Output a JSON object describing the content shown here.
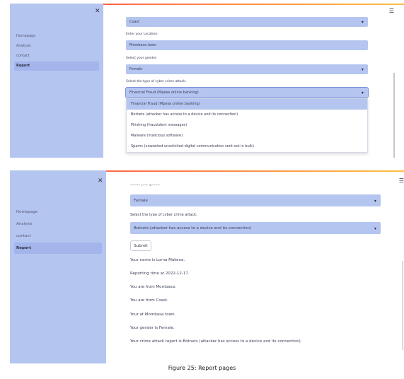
{
  "panel1": {
    "nav": [
      "Homepage",
      "Analysis",
      "contact",
      "Report"
    ],
    "active_nav": "Report",
    "region_value": "Coast",
    "location_label": "Enter your Location:",
    "location_value": "Mombasa town",
    "gender_label": "Select your gender:",
    "gender_value": "Female",
    "attack_label": "Select the type of cyber crime attack:",
    "attack_value": "Financial Fraud (Mpesa online banking)",
    "attack_options": [
      "Financial Fraud (Mpesa online banking)",
      "Botnets (attacker has access to a device and its connection)",
      "Phishing (fraudulent messages)",
      "Malware (malicious software)",
      "Spams (unwanted unsolicited digital communication sent out in bulk)"
    ]
  },
  "panel2": {
    "nav": [
      "Homepage",
      "Analysis",
      "contact",
      "Report"
    ],
    "active_nav": "Report",
    "gender_label_partial": "Select your gender:",
    "gender_value": "Female",
    "attack_label": "Select the type of cyber crime attack:",
    "attack_value": "Botnets (attacker has access to a device and its connection)",
    "submit_label": "Submit",
    "outputs": [
      "Your name is Lorna Makena.",
      "Reporting time at 2022-12-17.",
      "You are from Mombasa.",
      "You are from Coast.",
      "Your at Mombasa town.",
      "Your gender is Female.",
      "Your crime attack report is Botnets (attacker has access to a device and its connection)."
    ]
  },
  "icons": {
    "close": "close-icon",
    "menu": "hamburger-menu-icon",
    "caret": "chevron-down-icon"
  },
  "colors": {
    "sidebar": "#b4c5f0",
    "field": "#b4c5f0",
    "accent_start": "#ff4b4b",
    "accent_end": "#ffbd45"
  },
  "caption": "Figure 25: Report pages"
}
